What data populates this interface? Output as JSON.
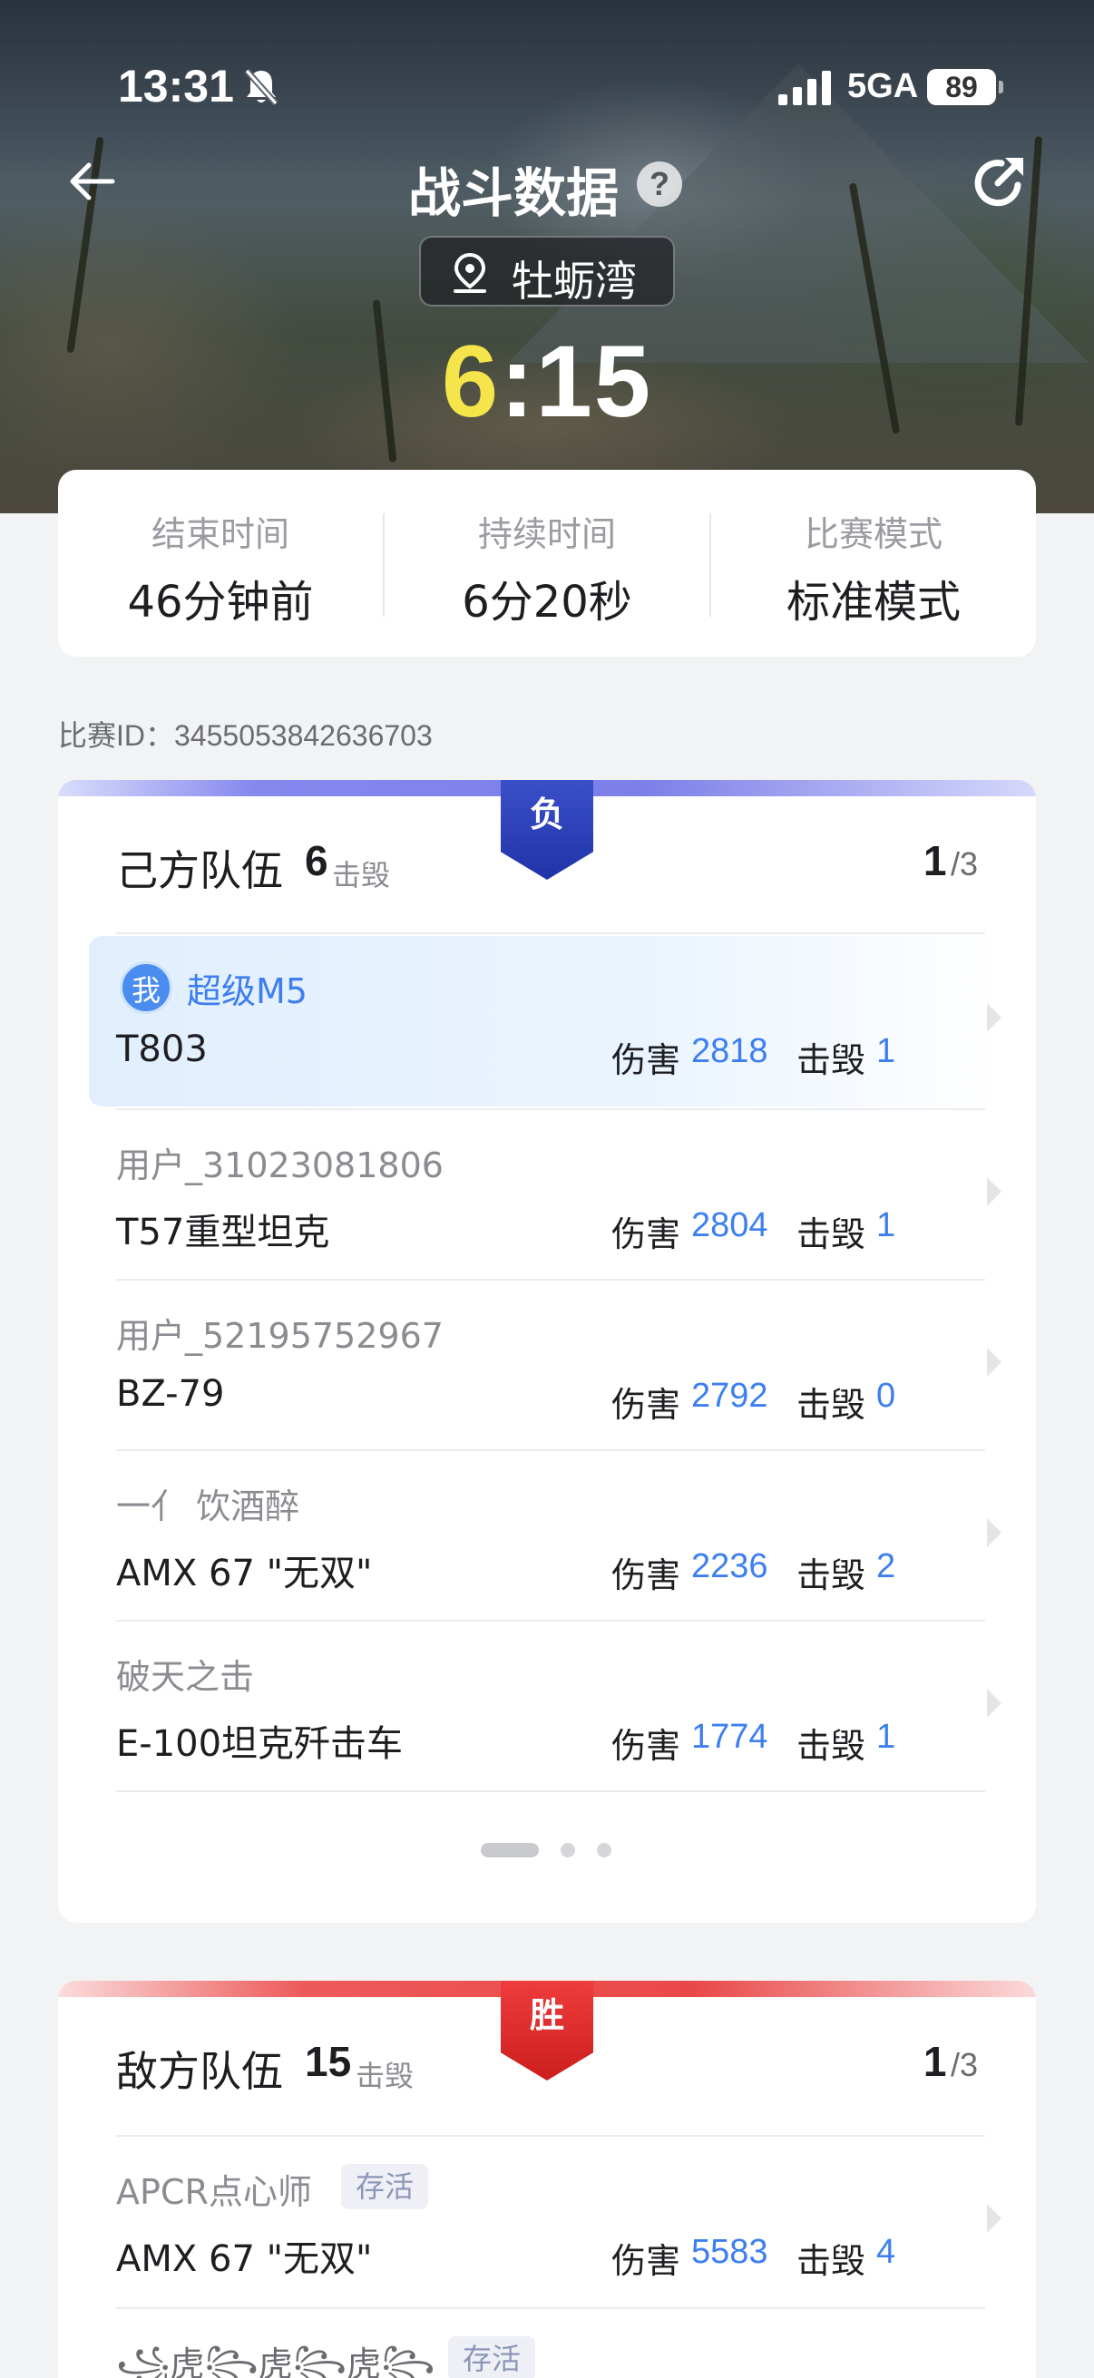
{
  "status_bar": {
    "time": "13:31",
    "network": "5GA",
    "battery": "89"
  },
  "header": {
    "title": "战斗数据",
    "help_icon": "?",
    "map_name": "牡蛎湾",
    "score_own": "6",
    "score_sep": ":",
    "score_enemy": "15"
  },
  "info": {
    "items": [
      {
        "label": "结束时间",
        "value": "46分钟前"
      },
      {
        "label": "持续时间",
        "value": "6分20秒"
      },
      {
        "label": "比赛模式",
        "value": "标准模式"
      }
    ],
    "match_id": "比赛ID：3455053842636703"
  },
  "own_team": {
    "title": "己方队伍",
    "kills": "6",
    "kills_unit": "击毁",
    "result": "负",
    "page_current": "1",
    "page_total": "/3",
    "pages": 3,
    "active_page": 1,
    "players": [
      {
        "name": "超级M5",
        "me_badge": "我",
        "tank": "T803",
        "damage_label": "伤害",
        "damage": "2818",
        "kills_label": "击毁",
        "kills": "1"
      },
      {
        "name": "用户_31023081806",
        "tank": "T57重型坦克",
        "damage_label": "伤害",
        "damage": "2804",
        "kills_label": "击毁",
        "kills": "1"
      },
      {
        "name": "用户_52195752967",
        "tank": "BZ-79",
        "damage_label": "伤害",
        "damage": "2792",
        "kills_label": "击毁",
        "kills": "0"
      },
      {
        "name": "一亻 饮酒醉",
        "tank": "AMX 67 \"无双\"",
        "damage_label": "伤害",
        "damage": "2236",
        "kills_label": "击毁",
        "kills": "2"
      },
      {
        "name": "破天之击",
        "tank": "E-100坦克歼击车",
        "damage_label": "伤害",
        "damage": "1774",
        "kills_label": "击毁",
        "kills": "1"
      }
    ]
  },
  "enemy_team": {
    "title": "敌方队伍",
    "kills": "15",
    "kills_unit": "击毁",
    "result": "胜",
    "page_current": "1",
    "page_total": "/3",
    "players": [
      {
        "name": "APCR点心师",
        "tag": "存活",
        "tank": "AMX 67 \"无双\"",
        "damage_label": "伤害",
        "damage": "5583",
        "kills_label": "击毁",
        "kills": "4"
      },
      {
        "name": "꧁虎꧂虎꧂虎꧂",
        "tag": "存活"
      }
    ]
  },
  "colors": {
    "accent_blue": "#3d7ff0",
    "lose_badge": "#2033a8",
    "win_badge": "#cc1e1e",
    "own_score": "#f5e44a"
  },
  "icons": [
    "bell-slash-icon",
    "signal-icon",
    "battery-icon",
    "back-arrow-icon",
    "help-icon",
    "share-icon",
    "location-pin-icon",
    "chevron-right-icon"
  ]
}
